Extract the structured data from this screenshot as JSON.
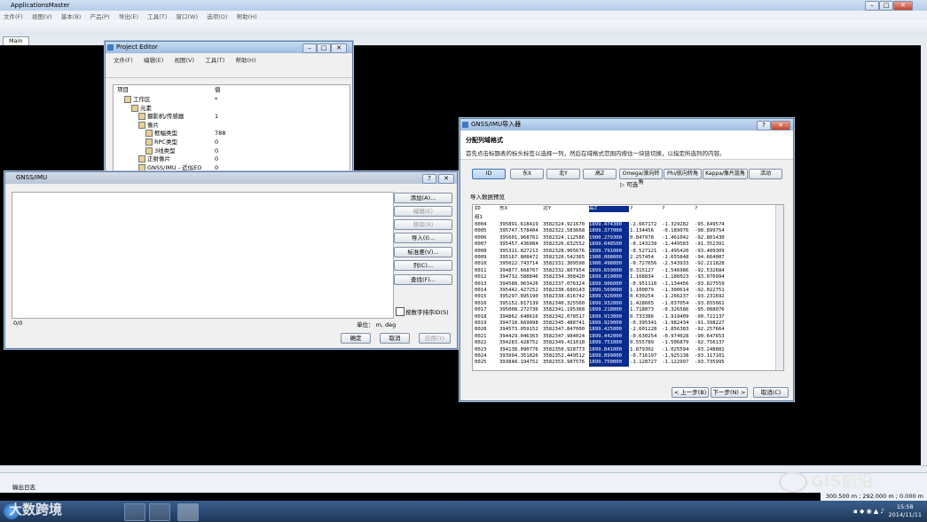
{
  "app": {
    "title": "ApplicationsMaster",
    "menu": [
      "文件(F)",
      "视图(V)",
      "基本(B)",
      "产品(P)",
      "导出(E)",
      "工具(T)",
      "窗口(W)",
      "选项(O)",
      "帮助(H)"
    ],
    "main_tab": "Main",
    "output_log": "输出日志",
    "coords": "300.500 m ; 292.000 m ; 0.000 m",
    "clock_time": "15:58",
    "clock_date": "2014/11/11"
  },
  "project_editor": {
    "title": "Project Editor",
    "menu": [
      "文件(F)",
      "编辑(E)",
      "视图(V)",
      "工具(T)",
      "帮助(H)"
    ],
    "col_item": "项目",
    "col_value": "值",
    "tree": [
      {
        "label": "工作区",
        "value": "*",
        "indent": 1
      },
      {
        "label": "元素",
        "value": "",
        "indent": 2
      },
      {
        "label": "摄影机/传感器",
        "value": "1",
        "indent": 3
      },
      {
        "label": "像片",
        "value": "",
        "indent": 3
      },
      {
        "label": "框幅类型",
        "value": "788",
        "indent": 4
      },
      {
        "label": "RPC类型",
        "value": "0",
        "indent": 4
      },
      {
        "label": "3线类型",
        "value": "0",
        "indent": 4
      },
      {
        "label": "正射像片",
        "value": "0",
        "indent": 3
      },
      {
        "label": "GNSS/IMU - 近似EO",
        "value": "0",
        "indent": 3
      }
    ]
  },
  "gnss_imu": {
    "title": "GNSS/IMU",
    "buttons": {
      "add": "添加(A)...",
      "edit": "编辑(E)",
      "delete": "移除(R)",
      "import": "导入(I)...",
      "standard": "标准差(V)...",
      "columns": "列(C)...",
      "find": "查找(F)..."
    },
    "sort_checkbox": "按数字排序ID(S)",
    "count": "0/0",
    "unit_label": "单位： m, deg",
    "ok": "确定",
    "cancel": "取消",
    "apply": "应用(Y)"
  },
  "gnss_import": {
    "title": "GNSS/IMU导入器",
    "heading": "分配列域格式",
    "instruction": "首先点击标题表的标头标签以选择一列，然后在域格式范围内按住一块链切换，以指定所选列的内容。",
    "col_buttons": [
      "ID",
      "东X",
      "北Y",
      "高Z",
      "Omega/滚向转角",
      "Phi/航向转角",
      "Kappa/像片旋角",
      "活动"
    ],
    "optional": "▷ 可选",
    "data_label": "导入数据预览",
    "grid_headers": [
      "ID",
      "东X",
      "北Y",
      "高Z",
      "?",
      "?",
      "?"
    ],
    "group_row": "组1",
    "rows": [
      [
        "0004",
        "395891.618419",
        "3582324.921670",
        "1899.474300",
        "-2.667172",
        "-1.329282",
        "-95.649574"
      ],
      [
        "0005",
        "395747.578404",
        "3582322.583668",
        "1899.377000",
        "1.134456",
        "-0.189076",
        "-98.899754"
      ],
      [
        "0006",
        "395601.968761",
        "3582324.112586",
        "1900.279300",
        "0.847978",
        "-1.461042",
        "-92.801430"
      ],
      [
        "0007",
        "395457.436084",
        "3582326.632552",
        "1899.648500",
        "-0.143239",
        "-1.449583",
        "-91.352391"
      ],
      [
        "0008",
        "395311.827213",
        "3582328.965676",
        "1899.791000",
        "-0.527121",
        "-1.495420",
        "-93.409309"
      ],
      [
        "0009",
        "395167.808472",
        "3582328.542365",
        "1900.008000",
        "2.257454",
        "-1.655848",
        "-94.664087"
      ],
      [
        "0010",
        "395022.743714",
        "3582331.309598",
        "1900.498000",
        "-0.727656",
        "-2.543933",
        "-92.211828"
      ],
      [
        "0011",
        "394877.668767",
        "3582332.807954",
        "1899.659000",
        "0.315127",
        "-1.546986",
        "-92.532684"
      ],
      [
        "0012",
        "394732.588846",
        "3582334.308420",
        "1899.819000",
        "1.168834",
        "-1.186023",
        "-93.076994"
      ],
      [
        "0013",
        "394588.063426",
        "3582337.076324",
        "1899.906000",
        "-0.951110",
        "-1.134456",
        "-93.827559"
      ],
      [
        "0014",
        "395442.427252",
        "3582338.680143",
        "1899.569000",
        "1.100079",
        "-1.300614",
        "-92.022751"
      ],
      [
        "0015",
        "395297.895190",
        "3582338.816742",
        "1899.926000",
        "0.630254",
        "-1.266237",
        "-93.231692"
      ],
      [
        "0016",
        "395152.817139",
        "3582340.325560",
        "1899.932000",
        "1.428665",
        "-1.037054",
        "-93.655661"
      ],
      [
        "0017",
        "395008.272736",
        "3582341.195368",
        "1899.218000",
        "1.718873",
        "-0.326586",
        "-95.088076"
      ],
      [
        "0018",
        "394862.648616",
        "3582342.078517",
        "1899.913000",
        "0.733386",
        "-1.919409",
        "-90.722137"
      ],
      [
        "0019",
        "394718.669098",
        "3582345.488741",
        "1899.929000",
        "-0.395341",
        "-1.982434",
        "-91.398227"
      ],
      [
        "0020",
        "394573.059152",
        "3582347.847000",
        "1899.425000",
        "-2.601228",
        "-1.856383",
        "-92.257664"
      ],
      [
        "0021",
        "394429.046363",
        "3582347.984024",
        "1899.442000",
        "-0.630254",
        "-0.974028",
        "-90.647653"
      ],
      [
        "0022",
        "394283.428752",
        "3582349.411018",
        "1899.751000",
        "0.555789",
        "-1.506879",
        "-92.756137"
      ],
      [
        "0023",
        "394138.090776",
        "3582350.928773",
        "1899.841000",
        "1.879302",
        "-1.025594",
        "-93.248881"
      ],
      [
        "0024",
        "393994.351826",
        "3582352.449512",
        "1899.899000",
        "-0.716197",
        "-1.925138",
        "-93.117101"
      ],
      [
        "0025",
        "393848.194752",
        "3582353.987576",
        "1899.750000",
        "-1.128727",
        "-1.122997",
        "-93.735995"
      ]
    ],
    "back": "< 上一步(B)",
    "next": "下一步(N) >",
    "cancel": "取消(C)"
  },
  "watermarks": {
    "left": "大数跨境",
    "right": "GIS前沿"
  }
}
